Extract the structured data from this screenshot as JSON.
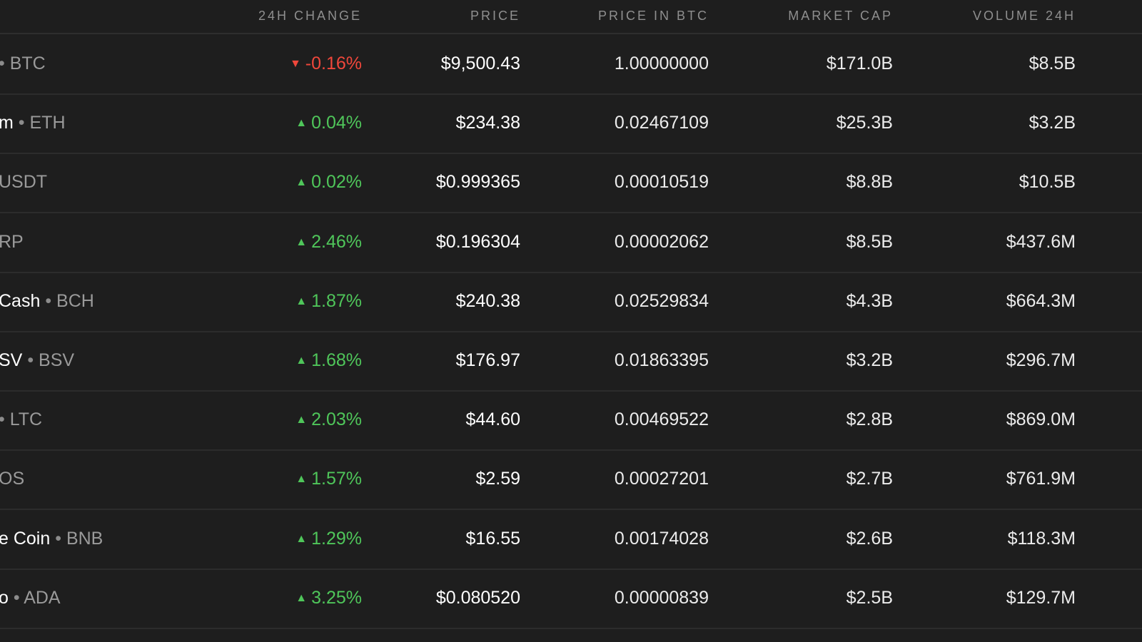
{
  "columns": {
    "change": "24H CHANGE",
    "price": "PRICE",
    "price_btc": "PRICE IN BTC",
    "market_cap": "MARKET CAP",
    "volume": "VOLUME 24H"
  },
  "colors": {
    "background": "#1e1e1e",
    "up": "#4fc65a",
    "down": "#f0473b",
    "muted": "#8f8f8f"
  },
  "rows": [
    {
      "name": "",
      "sep": "•",
      "symbol": "BTC",
      "direction": "down",
      "change": "-0.16%",
      "price": "$9,500.43",
      "price_btc": "1.00000000",
      "market_cap": "$171.0B",
      "volume": "$8.5B"
    },
    {
      "name": "m",
      "sep": "•",
      "symbol": "ETH",
      "direction": "up",
      "change": "0.04%",
      "price": "$234.38",
      "price_btc": "0.02467109",
      "market_cap": "$25.3B",
      "volume": "$3.2B"
    },
    {
      "name": "",
      "sep": "",
      "symbol": "USDT",
      "direction": "up",
      "change": "0.02%",
      "price": "$0.999365",
      "price_btc": "0.00010519",
      "market_cap": "$8.8B",
      "volume": "$10.5B"
    },
    {
      "name": "",
      "sep": "",
      "symbol": "RP",
      "direction": "up",
      "change": "2.46%",
      "price": "$0.196304",
      "price_btc": "0.00002062",
      "market_cap": "$8.5B",
      "volume": "$437.6M"
    },
    {
      "name": "Cash",
      "sep": "•",
      "symbol": "BCH",
      "direction": "up",
      "change": "1.87%",
      "price": "$240.38",
      "price_btc": "0.02529834",
      "market_cap": "$4.3B",
      "volume": "$664.3M"
    },
    {
      "name": "SV",
      "sep": "•",
      "symbol": "BSV",
      "direction": "up",
      "change": "1.68%",
      "price": "$176.97",
      "price_btc": "0.01863395",
      "market_cap": "$3.2B",
      "volume": "$296.7M"
    },
    {
      "name": "",
      "sep": "•",
      "symbol": "LTC",
      "direction": "up",
      "change": "2.03%",
      "price": "$44.60",
      "price_btc": "0.00469522",
      "market_cap": "$2.8B",
      "volume": "$869.0M"
    },
    {
      "name": "",
      "sep": "",
      "symbol": "OS",
      "direction": "up",
      "change": "1.57%",
      "price": "$2.59",
      "price_btc": "0.00027201",
      "market_cap": "$2.7B",
      "volume": "$761.9M"
    },
    {
      "name": "e Coin",
      "sep": "•",
      "symbol": "BNB",
      "direction": "up",
      "change": "1.29%",
      "price": "$16.55",
      "price_btc": "0.00174028",
      "market_cap": "$2.6B",
      "volume": "$118.3M"
    },
    {
      "name": "o",
      "sep": "•",
      "symbol": "ADA",
      "direction": "up",
      "change": "3.25%",
      "price": "$0.080520",
      "price_btc": "0.00000839",
      "market_cap": "$2.5B",
      "volume": "$129.7M"
    }
  ]
}
